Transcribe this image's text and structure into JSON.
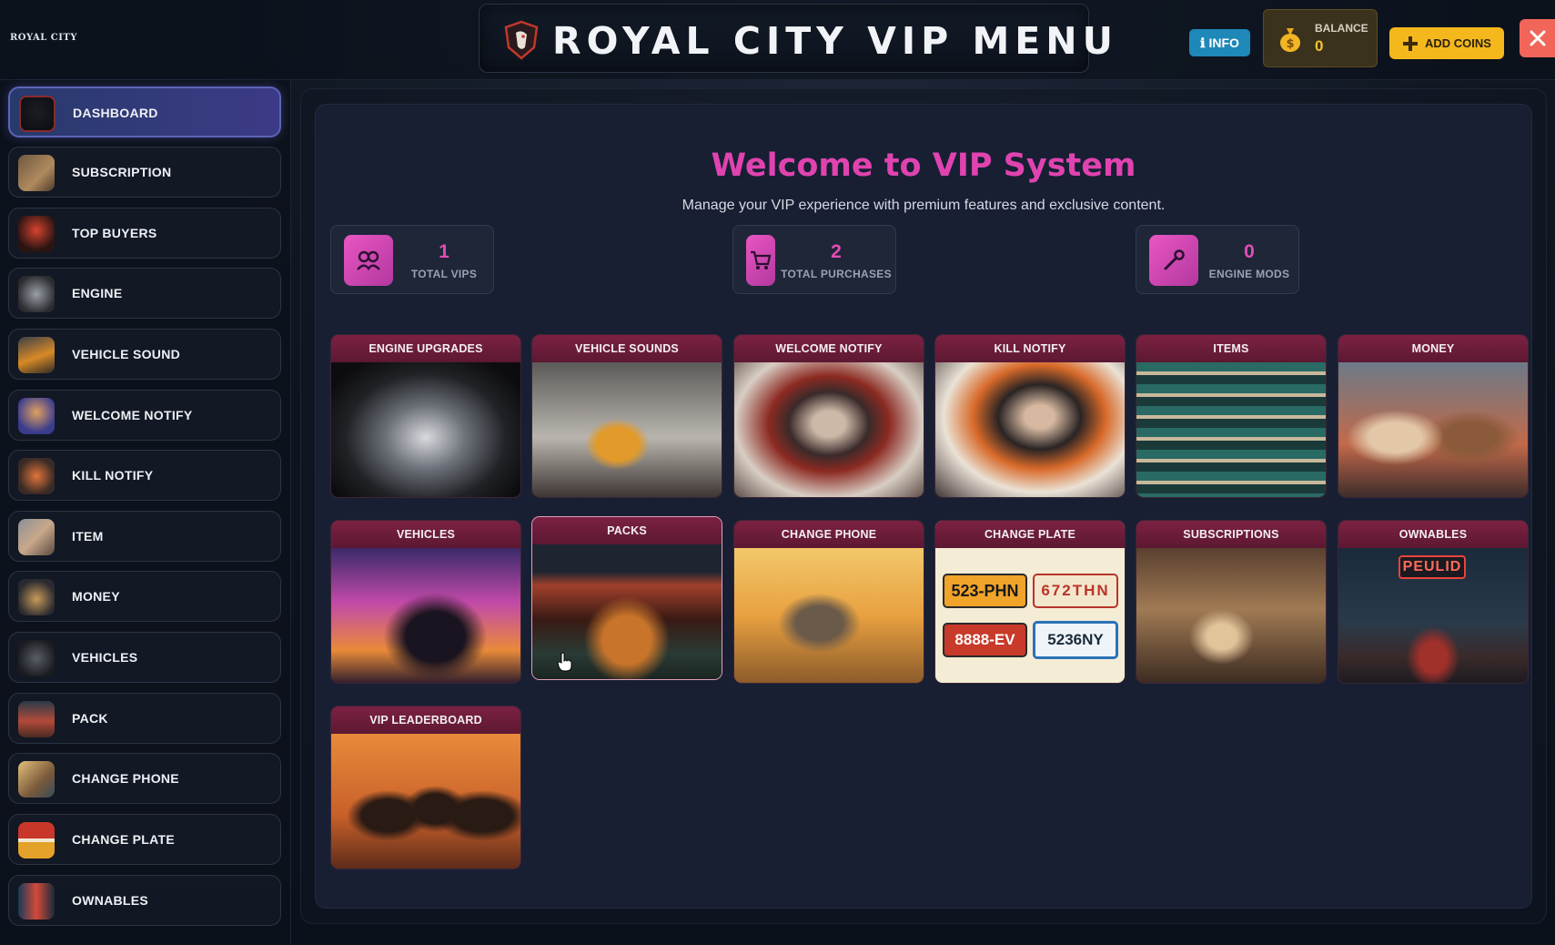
{
  "header": {
    "brand": "ROYAL CITY",
    "title": "ROYAL CITY VIP MENU",
    "info_label": "INFO",
    "balance_label": "BALANCE",
    "balance_value": "0",
    "add_coins_label": "ADD COINS"
  },
  "sidebar": {
    "items": [
      {
        "label": "DASHBOARD",
        "active": true
      },
      {
        "label": "SUBSCRIPTION"
      },
      {
        "label": "TOP BUYERS"
      },
      {
        "label": "ENGINE"
      },
      {
        "label": "VEHICLE SOUND"
      },
      {
        "label": "WELCOME NOTIFY"
      },
      {
        "label": "KILL NOTIFY"
      },
      {
        "label": "ITEM"
      },
      {
        "label": "MONEY"
      },
      {
        "label": "VEHICLES"
      },
      {
        "label": "PACK"
      },
      {
        "label": "CHANGE PHONE"
      },
      {
        "label": "CHANGE PLATE"
      },
      {
        "label": "OWNABLES"
      }
    ]
  },
  "main": {
    "welcome_title": "Welcome to VIP System",
    "subtitle": "Manage your VIP experience with premium features and exclusive content.",
    "stats": [
      {
        "value": "1",
        "label": "TOTAL VIPS",
        "icon": "users-icon"
      },
      {
        "value": "2",
        "label": "TOTAL PURCHASES",
        "icon": "cart-icon"
      },
      {
        "value": "0",
        "label": "ENGINE MODS",
        "icon": "wrench-icon"
      }
    ],
    "cards": [
      {
        "title": "ENGINE UPGRADES"
      },
      {
        "title": "VEHICLE SOUNDS"
      },
      {
        "title": "WELCOME NOTIFY"
      },
      {
        "title": "KILL NOTIFY"
      },
      {
        "title": "ITEMS"
      },
      {
        "title": "MONEY"
      },
      {
        "title": "VEHICLES"
      },
      {
        "title": "PACKS"
      },
      {
        "title": "CHANGE PHONE"
      },
      {
        "title": "CHANGE PLATE"
      },
      {
        "title": "SUBSCRIPTIONS"
      },
      {
        "title": "OWNABLES"
      },
      {
        "title": "VIP LEADERBOARD"
      }
    ],
    "plates": [
      "523-PHN",
      "672THN",
      "8888-EV",
      "5236NY"
    ],
    "ownables_sign": "PEULID"
  },
  "colors": {
    "accent_pink": "#e043b0",
    "card_header": "#7c2142",
    "info_blue": "#1e88b8",
    "gold": "#f5b81c",
    "close_red": "#f26659"
  }
}
